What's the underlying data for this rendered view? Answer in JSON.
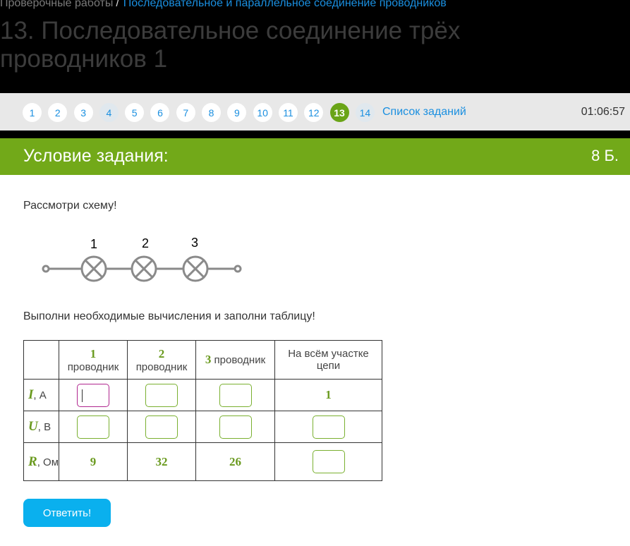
{
  "breadcrumb": {
    "parent": "Проверочные работы",
    "separator": "/",
    "current": "Последовательное и параллельное соединение проводников"
  },
  "page_title": "13. Последовательное соединение трёх проводников 1",
  "nav": {
    "pages": [
      "1",
      "2",
      "3",
      "4",
      "5",
      "6",
      "7",
      "8",
      "9",
      "10",
      "11",
      "12",
      "13",
      "14"
    ],
    "active_page": "13",
    "task_list_label": "Список заданий",
    "timer": "01:06:57"
  },
  "condition": {
    "title": "Условие задания:",
    "points": "8 Б."
  },
  "task": {
    "prompt_1": "Рассмотри схему!",
    "prompt_2": "Выполни необходимые вычисления и заполни таблицу!"
  },
  "diagram": {
    "labels": [
      "1",
      "2",
      "3"
    ]
  },
  "table": {
    "headers": [
      {
        "num": "1",
        "text": "проводник"
      },
      {
        "num": "2",
        "text": "проводник"
      },
      {
        "num": "3",
        "text": "проводник"
      },
      {
        "num": "",
        "text": "На всём участке цепи"
      }
    ],
    "rows": [
      {
        "symbol": "I",
        "unit": ", А",
        "values": [
          "",
          "",
          "",
          "1"
        ]
      },
      {
        "symbol": "U",
        "unit": ", В",
        "values": [
          "",
          "",
          "",
          ""
        ]
      },
      {
        "symbol": "R",
        "unit": ", Ом",
        "values": [
          "9",
          "32",
          "26",
          ""
        ]
      }
    ]
  },
  "submit_label": "Ответить!",
  "colors": {
    "accent_green": "#72a919",
    "link_blue": "#1a8fe0",
    "button_blue": "#0ab0ee",
    "focus_border": "#b0268e"
  }
}
